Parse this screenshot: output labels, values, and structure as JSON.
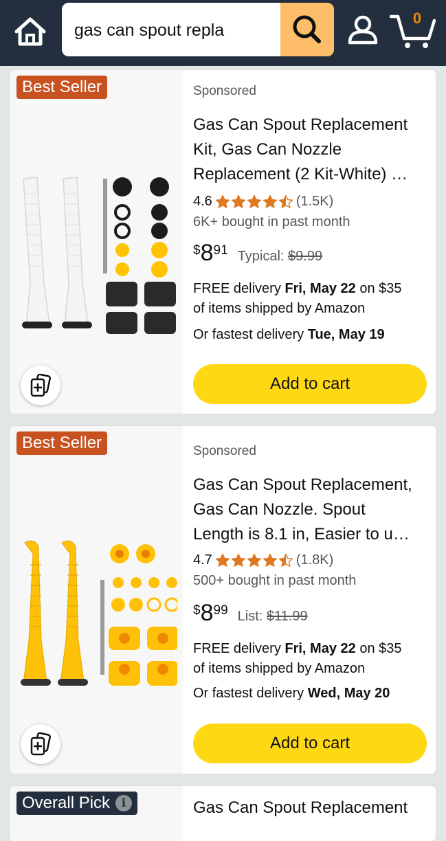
{
  "header": {
    "search_value": "gas can spout repla",
    "cart_count": "0",
    "icons": [
      "home-icon",
      "search-icon",
      "account-icon",
      "cart-icon"
    ],
    "colors": {
      "bar": "#232f3e",
      "search_button": "#febd69",
      "cart_count": "#f08804"
    }
  },
  "products": [
    {
      "badge": "Best Seller",
      "sponsored": "Sponsored",
      "title_line1": "Gas Can Spout Replacement",
      "title_line2": "Kit, Gas Can Nozzle",
      "title_line3": "Replacement (2 Kit-White) …",
      "rating": "4.6",
      "stars": 4.5,
      "rating_count": "(1.5K)",
      "bought": "6K+ bought in past month",
      "price_symbol": "$",
      "price_whole": "8",
      "price_fraction": "91",
      "ref_label": "Typical:",
      "ref_price": "$9.99",
      "delivery_prefix": "FREE delivery ",
      "delivery_date": "Fri, May 22",
      "delivery_suffix": " on $35",
      "delivery_line2": "of items shipped by Amazon",
      "fastest_prefix": "Or fastest delivery ",
      "fastest_date": "Tue, May 19",
      "cart_button": "Add to cart",
      "image_color": "#ffffff"
    },
    {
      "badge": "Best Seller",
      "sponsored": "Sponsored",
      "title_line1": "Gas Can Spout Replacement,",
      "title_line2": "Gas Can Nozzle. Spout",
      "title_line3": "Length is 8.1 in, Easier to u…",
      "rating": "4.7",
      "stars": 4.5,
      "rating_count": "(1.8K)",
      "bought": "500+ bought in past month",
      "price_symbol": "$",
      "price_whole": "8",
      "price_fraction": "99",
      "ref_label": "List:",
      "ref_price": "$11.99",
      "delivery_prefix": "FREE delivery ",
      "delivery_date": "Fri, May 22",
      "delivery_suffix": " on $35",
      "delivery_line2": "of items shipped by Amazon",
      "fastest_prefix": "Or fastest delivery ",
      "fastest_date": "Wed, May 20",
      "cart_button": "Add to cart",
      "image_color": "#ffc107"
    },
    {
      "badge": "Overall Pick",
      "badge_info_icon": "i",
      "title_line1": "Gas Can Spout Replacement"
    }
  ],
  "colors": {
    "best_seller": "#c7511f",
    "overall_pick": "#232f3e",
    "add_to_cart": "#ffd814",
    "star": "#de7921"
  }
}
